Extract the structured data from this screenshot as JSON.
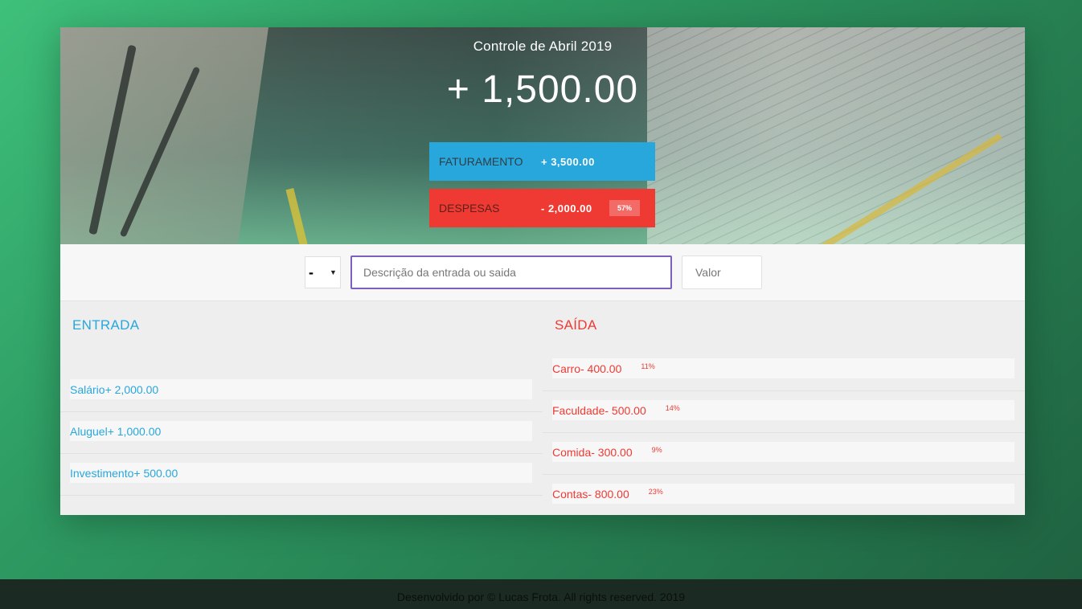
{
  "header": {
    "title": "Controle de Abril 2019",
    "total": "+ 1,500.00",
    "income": {
      "label": "Faturamento",
      "value": "+ 3,500.00"
    },
    "expense": {
      "label": "Despesas",
      "value": "- 2,000.00",
      "percent": "57%"
    }
  },
  "form": {
    "type_value": "-",
    "description_placeholder": "Descrição da entrada ou saida",
    "value_placeholder": "Valor"
  },
  "income_list": {
    "title": "Entrada",
    "items": [
      {
        "text": "Salário+ 2,000.00"
      },
      {
        "text": "Aluguel+ 1,000.00"
      },
      {
        "text": "Investimento+ 500.00"
      }
    ]
  },
  "expense_list": {
    "title": "Saída",
    "items": [
      {
        "text": "Carro- 400.00",
        "percent": "11%"
      },
      {
        "text": "Faculdade- 500.00",
        "percent": "14%"
      },
      {
        "text": "Comida- 300.00",
        "percent": "9%"
      },
      {
        "text": "Contas- 800.00",
        "percent": "23%"
      }
    ]
  },
  "footer": {
    "text": "Desenvolvido por © Lucas Frota. All rights reserved. 2019"
  },
  "colors": {
    "income": "#28a7dd",
    "expense": "#ef3a34",
    "focus": "#7c5fbf"
  }
}
